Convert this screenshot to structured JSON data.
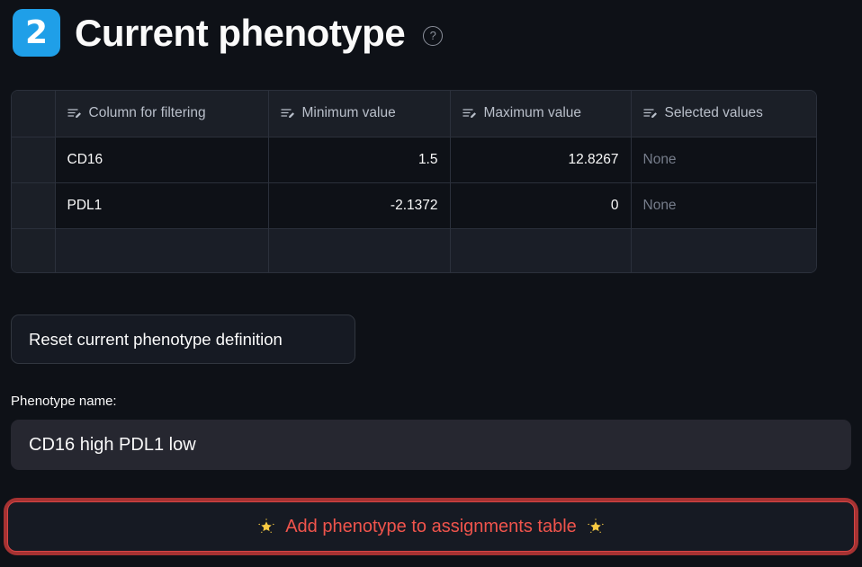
{
  "header": {
    "step_badge": "2",
    "title": "Current phenotype",
    "help_icon": "?",
    "badge_color": "#1f9fe8"
  },
  "table": {
    "columns": [
      {
        "label": "Column for filtering",
        "icon": "text-column-icon"
      },
      {
        "label": "Minimum value",
        "icon": "text-column-icon"
      },
      {
        "label": "Maximum value",
        "icon": "text-column-icon"
      },
      {
        "label": "Selected values",
        "icon": "text-column-icon"
      }
    ],
    "rows": [
      {
        "column": "CD16",
        "minimum": "1.5",
        "maximum": "12.8267",
        "selected": "None"
      },
      {
        "column": "PDL1",
        "minimum": "-2.1372",
        "maximum": "0",
        "selected": "None"
      },
      {
        "column": "",
        "minimum": "",
        "maximum": "",
        "selected": ""
      }
    ]
  },
  "reset_button": {
    "label": "Reset current phenotype definition"
  },
  "phenotype_name": {
    "label": "Phenotype name:",
    "value": "CD16 high PDL1 low",
    "placeholder": "Phenotype name"
  },
  "add_button": {
    "label": "Add phenotype to assignments table",
    "left_icon": "glowing-star-emoji",
    "right_icon": "glowing-star-emoji",
    "text_color": "#f0544c",
    "border_color": "#d64545",
    "highlight_color": "#a63232"
  }
}
